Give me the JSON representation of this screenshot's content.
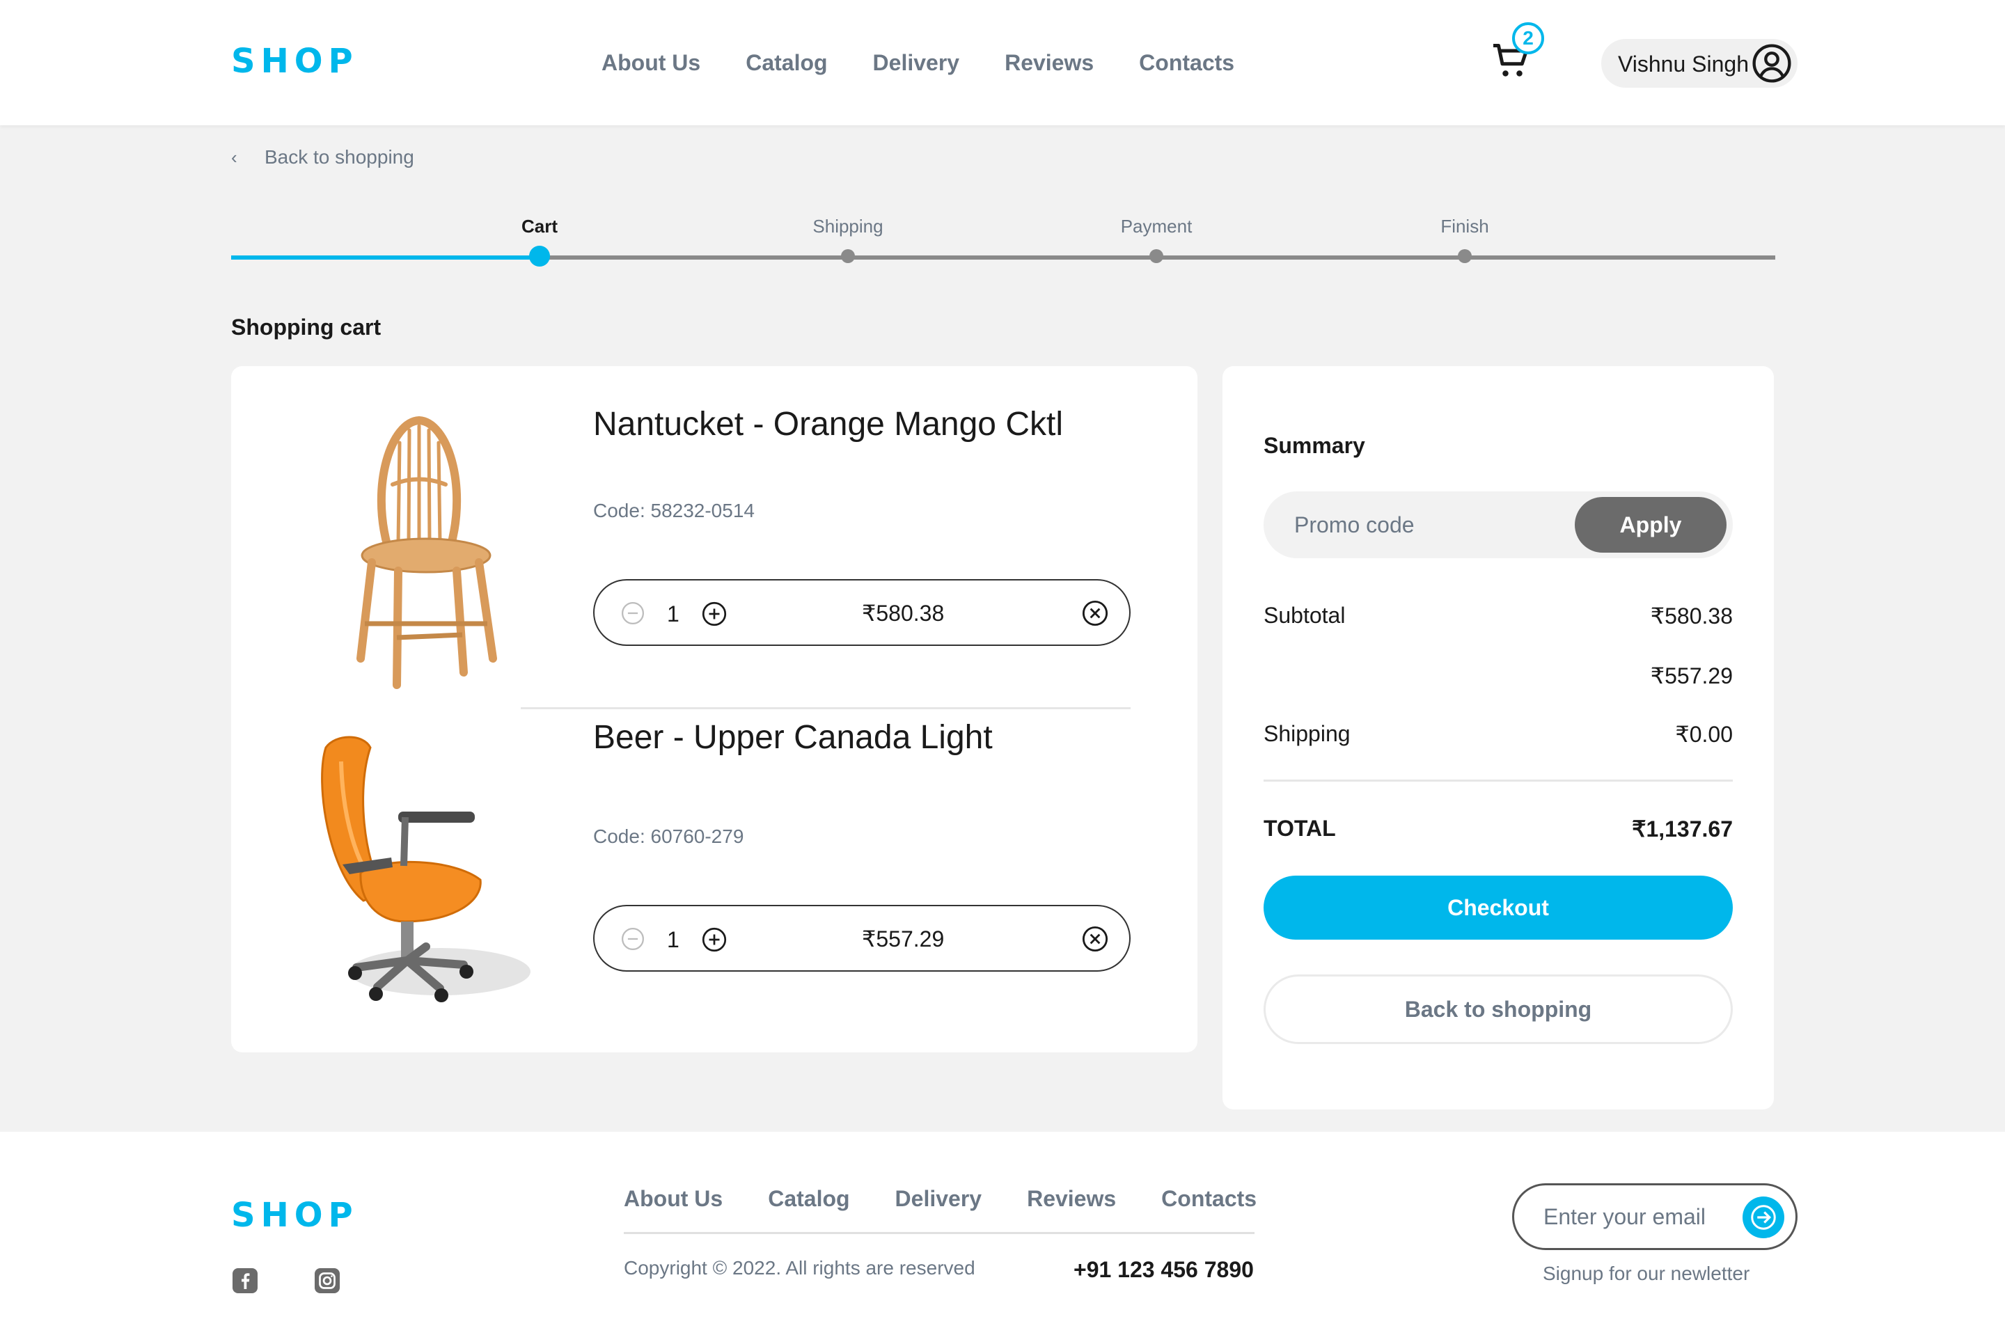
{
  "header": {
    "logo": "SHOP",
    "nav": [
      "About Us",
      "Catalog",
      "Delivery",
      "Reviews",
      "Contacts"
    ],
    "cart_count": "2",
    "user_name": "Vishnu Singh"
  },
  "back_link": "Back to shopping",
  "stepper": {
    "steps": [
      "Cart",
      "Shipping",
      "Payment",
      "Finish"
    ],
    "active_step": "Cart"
  },
  "section_title": "Shopping cart",
  "cart": {
    "items": [
      {
        "name": "Nantucket - Orange Mango Cktl",
        "code": "Code: 58232-0514",
        "qty": "1",
        "price": "₹580.38",
        "image": "wooden-chair"
      },
      {
        "name": "Beer - Upper Canada Light",
        "code": "Code: 60760-279",
        "qty": "1",
        "price": "₹557.29",
        "image": "orange-office-chair"
      }
    ]
  },
  "summary": {
    "title": "Summary",
    "promo_placeholder": "Promo code",
    "apply_label": "Apply",
    "subtotal_label": "Subtotal",
    "subtotal_value": "₹580.38",
    "second_value": "₹557.29",
    "shipping_label": "Shipping",
    "shipping_value": "₹0.00",
    "total_label": "TOTAL",
    "total_value": "₹1,137.67",
    "checkout_label": "Checkout",
    "back_label": "Back to shopping"
  },
  "footer": {
    "logo": "SHOP",
    "nav": [
      "About Us",
      "Catalog",
      "Delivery",
      "Reviews",
      "Contacts"
    ],
    "copyright": "Copyright © 2022. All rights are reserved",
    "phone": "+91 123 456 7890",
    "email_placeholder": "Enter your email",
    "signup_note": "Signup for our newletter"
  },
  "colors": {
    "accent": "#00b7eb",
    "muted": "#6b7785",
    "dark_button": "#6b6b6b",
    "background": "#f2f2f2"
  }
}
